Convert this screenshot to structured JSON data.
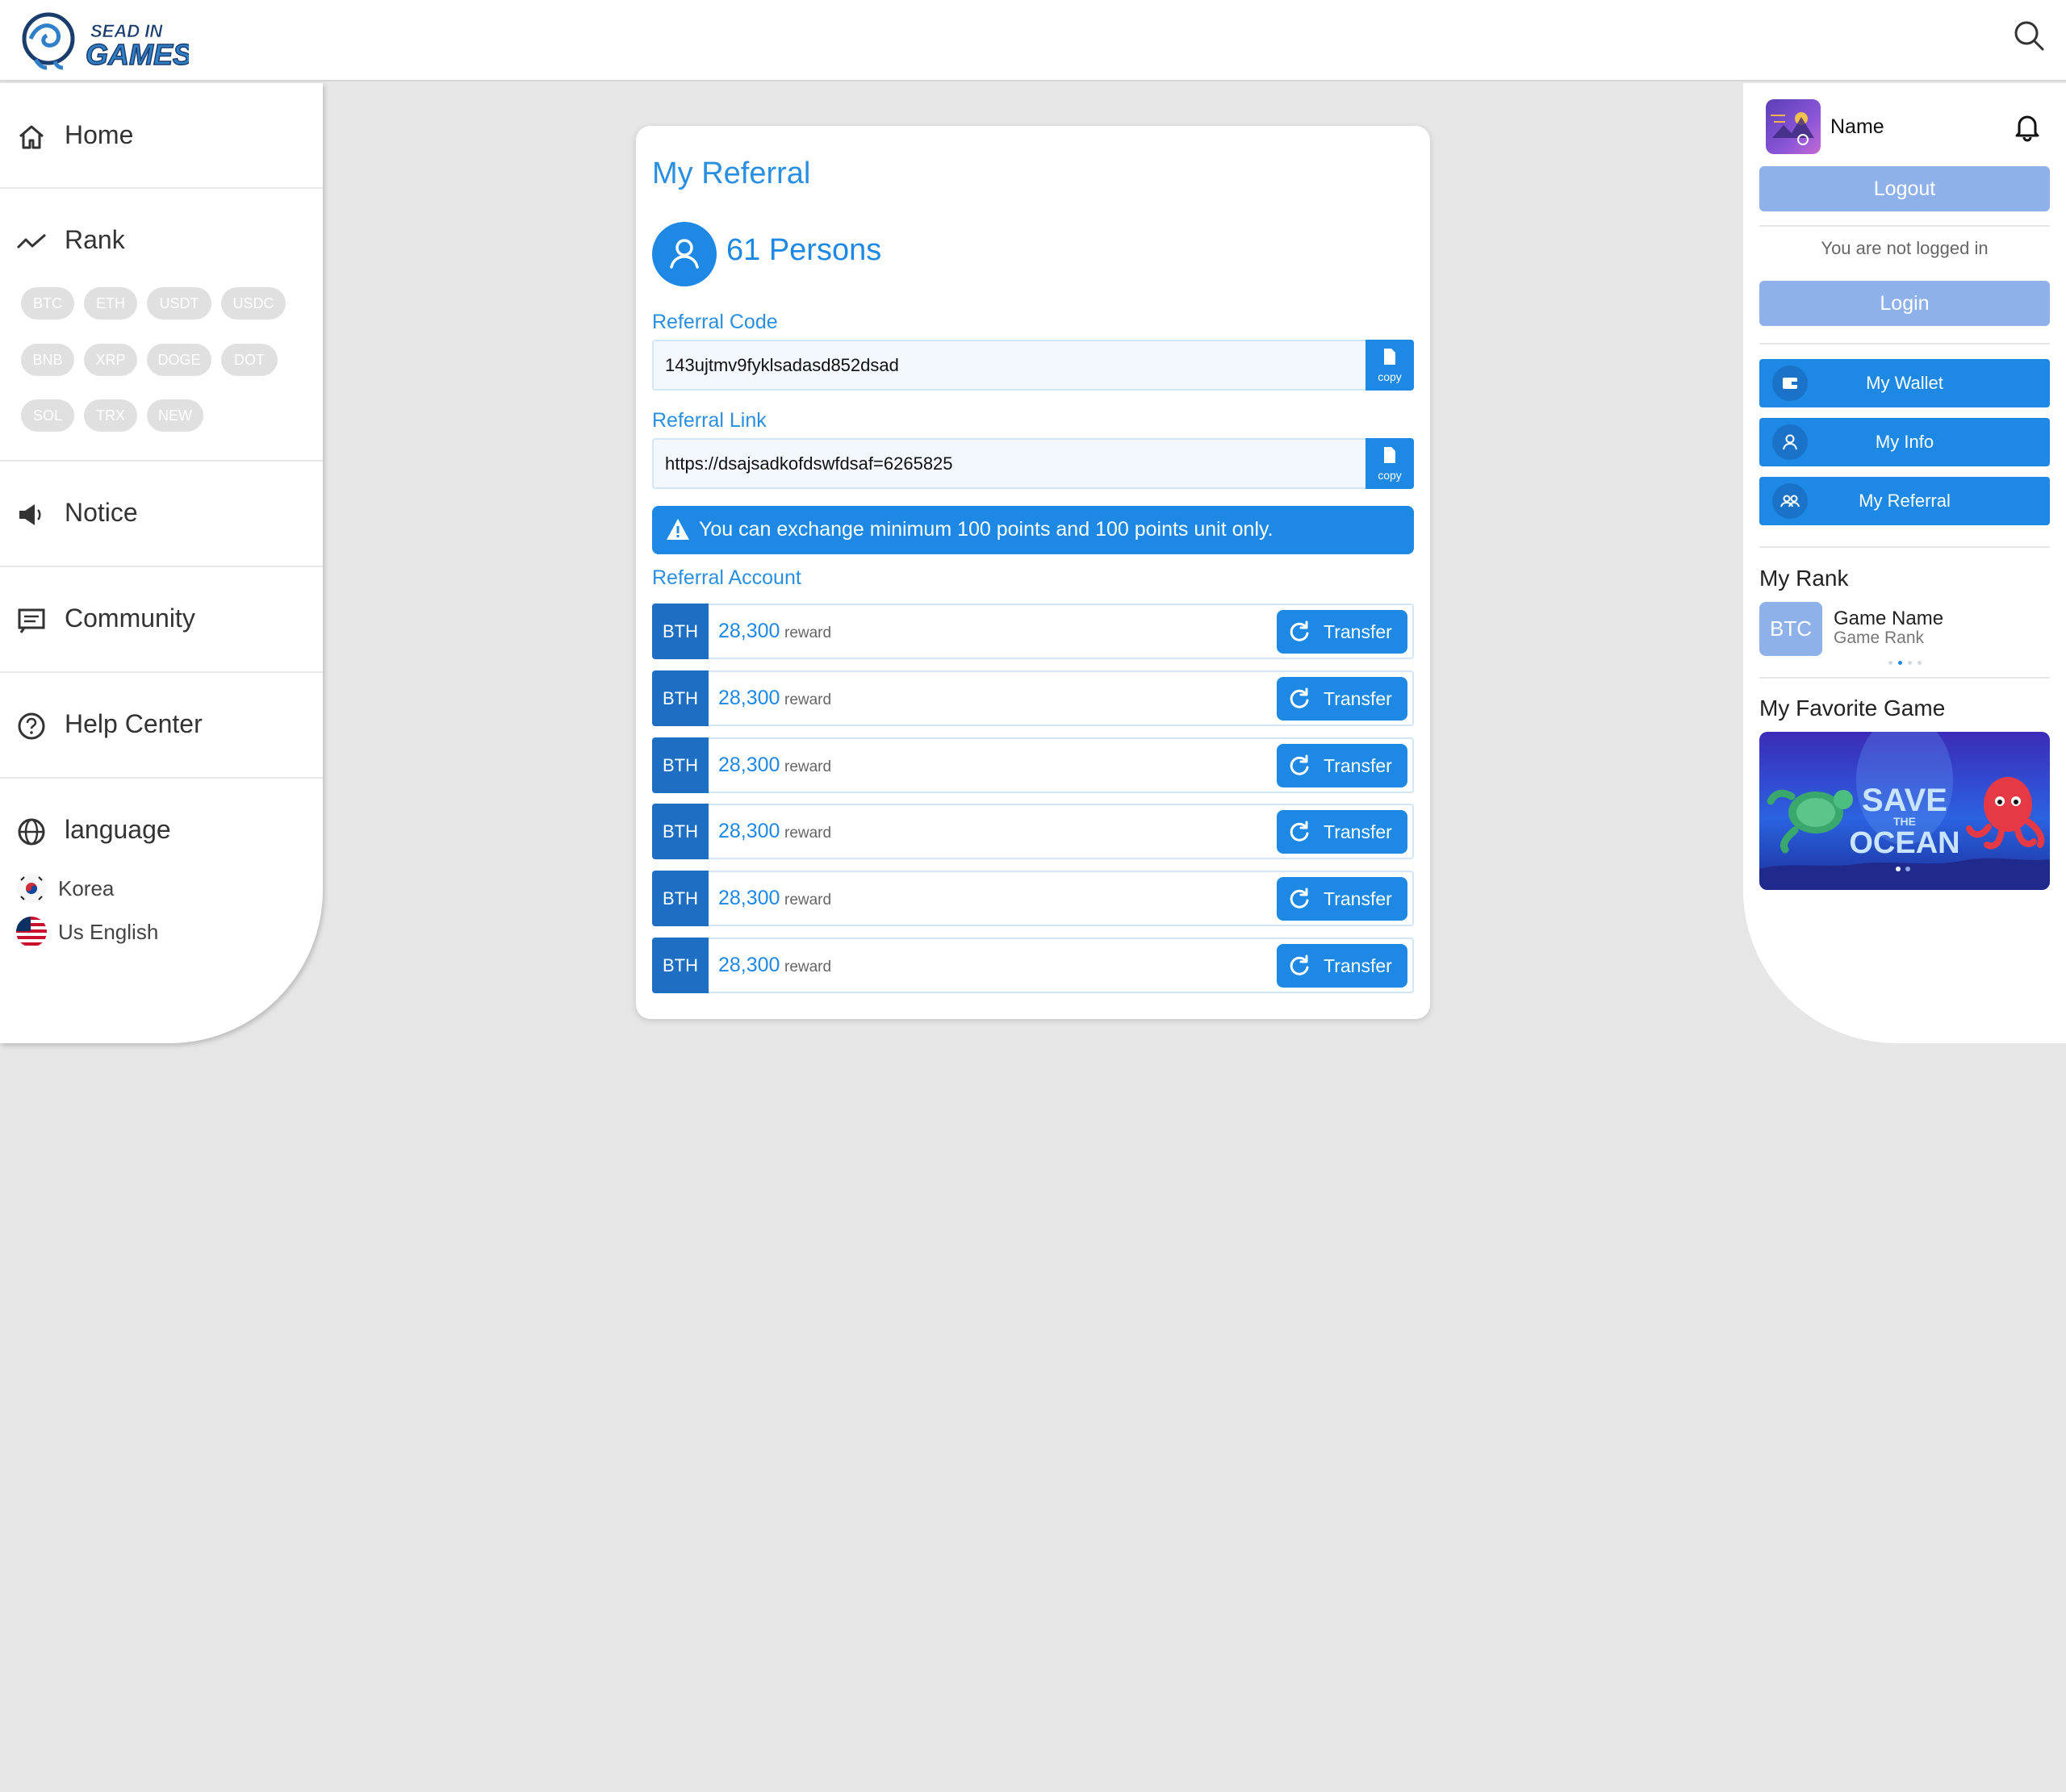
{
  "header": {
    "logo_line1": "SEAD IN",
    "logo_line2": "GAMES"
  },
  "sidebar": {
    "home": "Home",
    "rank": "Rank",
    "coins": [
      "BTC",
      "ETH",
      "USDT",
      "USDC",
      "BNB",
      "XRP",
      "DOGE",
      "DOT",
      "SOL",
      "TRX",
      "NEW"
    ],
    "notice": "Notice",
    "community": "Community",
    "help": "Help Center",
    "language": "language",
    "languages": [
      "Korea",
      "Us English"
    ]
  },
  "referral": {
    "title": "My Referral",
    "persons": "61 Persons",
    "code_label": "Referral Code",
    "code_value": "143ujtmv9fyklsadasd852dsad",
    "link_label": "Referral Link",
    "link_value": "https://dsajsadkofdswfdsaf=6265825",
    "copy_label": "copy",
    "notice": "You can exchange minimum 100 points and 100 points unit only.",
    "account_label": "Referral Account",
    "accounts": [
      {
        "symbol": "BTH",
        "amount": "28,300",
        "unit": "reward",
        "action": "Transfer"
      },
      {
        "symbol": "BTH",
        "amount": "28,300",
        "unit": "reward",
        "action": "Transfer"
      },
      {
        "symbol": "BTH",
        "amount": "28,300",
        "unit": "reward",
        "action": "Transfer"
      },
      {
        "symbol": "BTH",
        "amount": "28,300",
        "unit": "reward",
        "action": "Transfer"
      },
      {
        "symbol": "BTH",
        "amount": "28,300",
        "unit": "reward",
        "action": "Transfer"
      },
      {
        "symbol": "BTH",
        "amount": "28,300",
        "unit": "reward",
        "action": "Transfer"
      }
    ]
  },
  "right": {
    "name": "Name",
    "logout": "Logout",
    "not_logged": "You are not logged in",
    "login": "Login",
    "menu": [
      "My Wallet",
      "My Info",
      "My Referral"
    ],
    "rank_title": "My Rank",
    "rank_badge": "BTC",
    "game_name": "Game Name",
    "game_rank": "Game Rank",
    "fav_title": "My Favorite Game",
    "fav_game_title_1": "SAVE",
    "fav_game_title_2": "THE",
    "fav_game_title_3": "OCEAN"
  },
  "colors": {
    "accent": "#1e88e5",
    "accent_dark": "#1e6fc4",
    "muted_button": "#8fb1ea",
    "background": "#e6e6e6"
  }
}
